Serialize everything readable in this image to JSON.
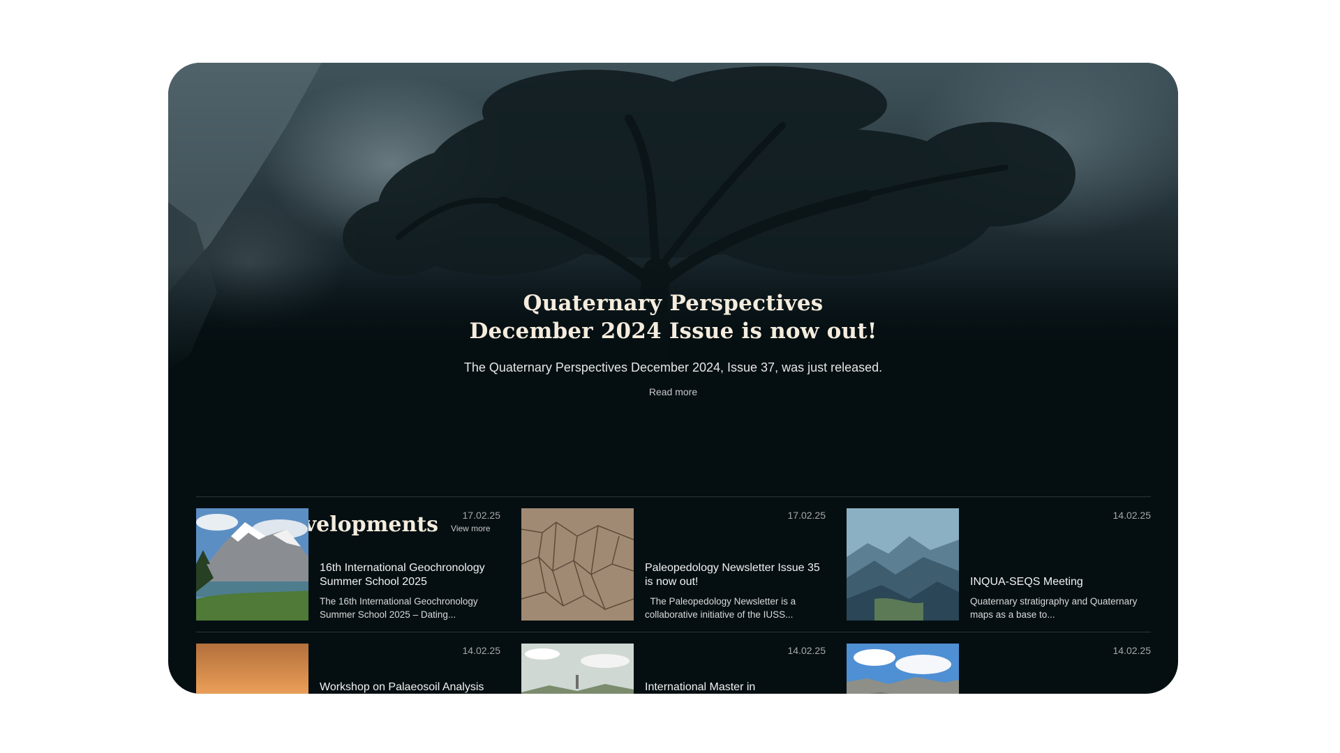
{
  "hero": {
    "title_line1": "Quaternary Perspectives",
    "title_line2": "December 2024 Issue is now out!",
    "description": "The Quaternary Perspectives December 2024, Issue 37, was just released.",
    "read_more": "Read more"
  },
  "latest": {
    "title": "Latest developments",
    "view_more": "View more",
    "items": [
      {
        "date": "17.02.25",
        "title": "16th International Geochronology Summer School 2025",
        "excerpt": "The 16th International Geochronology Summer School 2025 – Dating..."
      },
      {
        "date": "17.02.25",
        "title": "Paleopedology Newsletter Issue 35 is now out!",
        "excerpt": "  The Paleopedology Newsletter is a collaborative initiative of the IUSS..."
      },
      {
        "date": "14.02.25",
        "title": "INQUA-SEQS Meeting",
        "excerpt": "Quaternary stratigraphy and Quaternary maps as a base to..."
      },
      {
        "date": "14.02.25",
        "title": "Workshop on Palaeosoil Analysis",
        "excerpt": ""
      },
      {
        "date": "14.02.25",
        "title": "International Master in",
        "excerpt": ""
      },
      {
        "date": "14.02.25",
        "title": "",
        "excerpt": ""
      }
    ]
  }
}
